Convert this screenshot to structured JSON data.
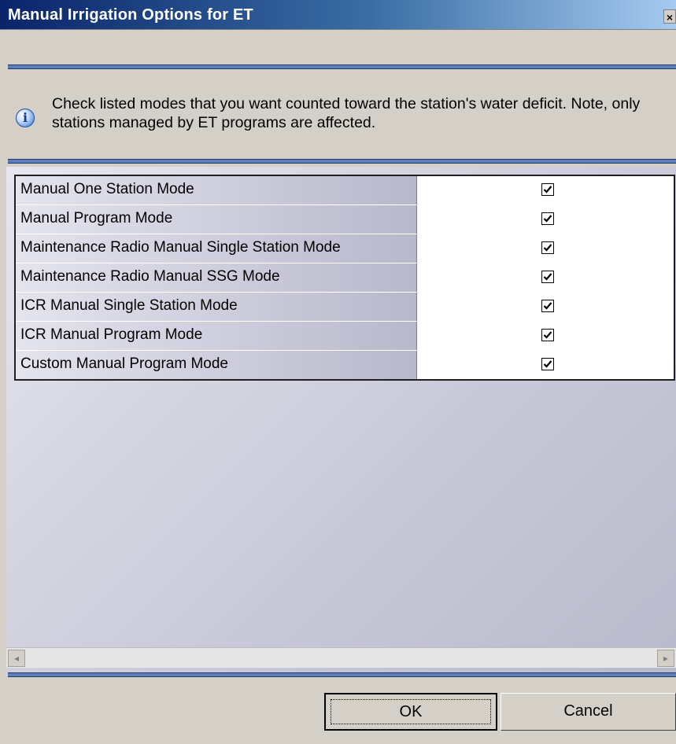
{
  "window": {
    "title": "Manual Irrigation Options for ET",
    "close_glyph": "×"
  },
  "info": {
    "icon": "info-icon",
    "glyph": "i",
    "text": "Check listed modes that you want counted toward the station's water deficit.  Note, only stations managed by ET programs are affected."
  },
  "modes": [
    {
      "label": "Manual One Station Mode",
      "checked": true
    },
    {
      "label": "Manual Program Mode",
      "checked": true
    },
    {
      "label": "Maintenance Radio Manual Single Station Mode",
      "checked": true
    },
    {
      "label": "Maintenance Radio Manual SSG Mode",
      "checked": true
    },
    {
      "label": "ICR Manual Single Station Mode",
      "checked": true
    },
    {
      "label": "ICR Manual Program Mode",
      "checked": true
    },
    {
      "label": "Custom Manual Program Mode",
      "checked": true
    }
  ],
  "scrollbar": {
    "left_glyph": "◂",
    "right_glyph": "▸"
  },
  "buttons": {
    "ok_label": "OK",
    "cancel_label": "Cancel"
  },
  "colors": {
    "title_start": "#0a246a",
    "title_end": "#a6caf0",
    "separator": "#5b7fb6",
    "dialog_bg": "#d4d0c8"
  }
}
